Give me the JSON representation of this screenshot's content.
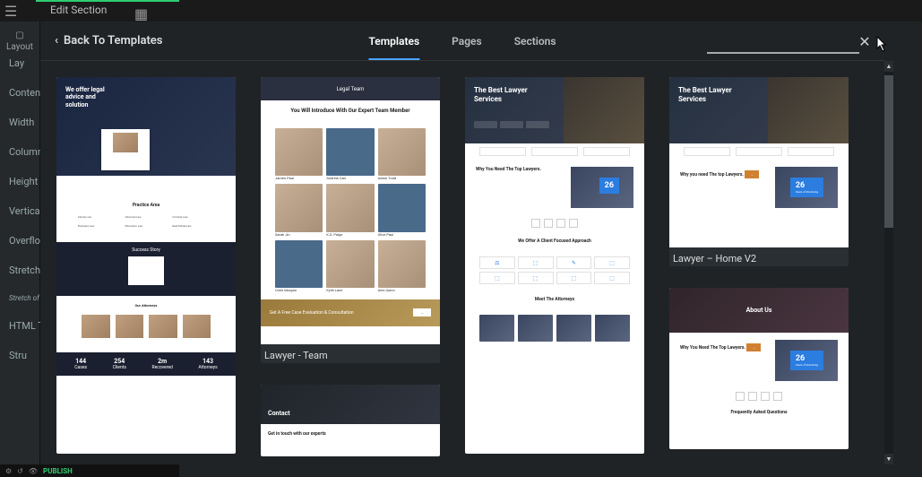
{
  "topbar": {
    "title": "Edit Section"
  },
  "sidebar": {
    "layout_label": "Layout",
    "items": [
      "Lay",
      "Conten",
      "Width",
      "Column",
      "Height",
      "Vertica",
      "Overflo",
      "Stretch",
      "Stretch of the p",
      "HTML T",
      "Stru"
    ]
  },
  "modal": {
    "back_label": "Back To Templates",
    "tabs": [
      "Templates",
      "Pages",
      "Sections"
    ],
    "active_tab": 0
  },
  "bottombar": {
    "publish": "PUBLISH"
  },
  "templates": {
    "col1_card1": {
      "hero_title": "We offer legal advice and solution",
      "practice_title": "Practice Area",
      "services": [
        "Family Law",
        "Personal Law",
        "Criminal Law",
        "Business Law",
        "Education Law",
        "Real Estate Law"
      ],
      "story_title": "Success Story",
      "attorneys_title": "Our Attorneys",
      "stats": [
        {
          "num": "144",
          "label": "Cases"
        },
        {
          "num": "254",
          "label": "Clients"
        },
        {
          "num": "2m",
          "label": "Recovered"
        },
        {
          "num": "143",
          "label": "Attorneys"
        }
      ]
    },
    "col2_card1": {
      "label": "Lawyer - Team",
      "hero_title": "Legal Team",
      "intro": "You Will Introduce With Our Expert Team Member",
      "names": [
        "James Paul",
        "Andrew Carr",
        "Adam Todd",
        "Sarah Jin",
        "K.D. Paige",
        "Olive Paul",
        "Chris Morgan",
        "Kylie Lane",
        "Alex Quinn"
      ],
      "cta": "Get A Free Case Evaluation & Consultation"
    },
    "col2_card2": {
      "hero_title": "Contact",
      "sub": "Get in touch with our experts"
    },
    "col3_card1": {
      "hero_title": "The Best Lawyer Services",
      "why_title": "Why You Need The Top Lawyers.",
      "badge": "26",
      "approach_title": "We Offer A Client Focused Approach",
      "icons": [
        "⚖",
        "⬚",
        "✎",
        "⬚",
        "⬚",
        "⬚",
        "⬚",
        "⬚"
      ],
      "meet_title": "Meet The Attorneys"
    },
    "col4_card1": {
      "label": "Lawyer – Home V2",
      "hero_title": "The Best Lawyer Services",
      "why_title": "Why you need The top Lawyers.",
      "badge": "26",
      "badge_sub": "Years of Practicing"
    },
    "col4_card2": {
      "hero_title": "About Us",
      "why_title": "Why You Need The Top Lawyers.",
      "badge": "26",
      "badge_sub": "Years of Practicing",
      "faq_title": "Frequently Asked Questions"
    }
  }
}
